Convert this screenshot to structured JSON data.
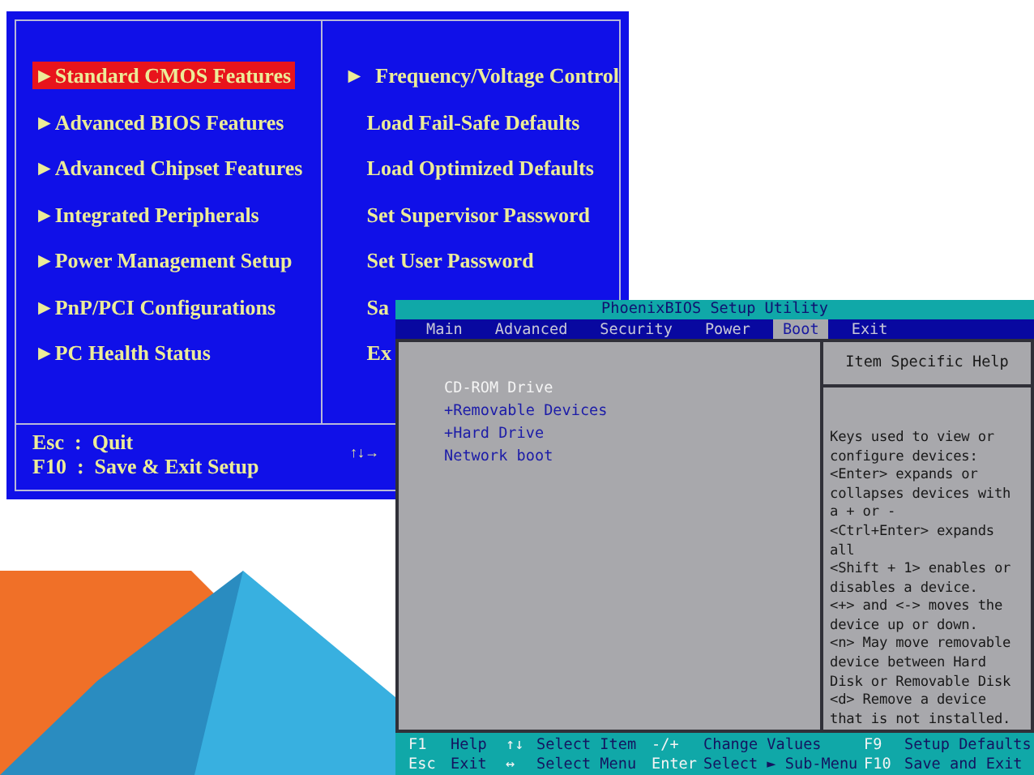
{
  "award_setup": {
    "left_menu": [
      {
        "arrow": "►",
        "label": "Standard CMOS Features",
        "selected": true
      },
      {
        "arrow": "►",
        "label": "Advanced BIOS Features",
        "selected": false
      },
      {
        "arrow": "►",
        "label": "Advanced Chipset Features",
        "selected": false
      },
      {
        "arrow": "►",
        "label": "Integrated Peripherals",
        "selected": false
      },
      {
        "arrow": "►",
        "label": "Power Management Setup",
        "selected": false
      },
      {
        "arrow": "►",
        "label": "PnP/PCI Configurations",
        "selected": false
      },
      {
        "arrow": "►",
        "label": "PC Health Status",
        "selected": false
      }
    ],
    "right_menu": [
      {
        "arrow": "►",
        "label": "Frequency/Voltage Control"
      },
      {
        "label": "Load Fail-Safe Defaults"
      },
      {
        "label": "Load Optimized Defaults"
      },
      {
        "label": "Set Supervisor Password"
      },
      {
        "label": "Set User Password"
      },
      {
        "label": "Sa"
      },
      {
        "label": "Ex"
      }
    ],
    "footer": [
      "Esc  :  Quit",
      "F10  :  Save & Exit Setup"
    ],
    "footer_keys": "↑↓→"
  },
  "phoenix_setup": {
    "title": "PhoenixBIOS Setup Utility",
    "tabs": [
      {
        "label": "Main",
        "selected": false
      },
      {
        "label": "Advanced",
        "selected": false
      },
      {
        "label": "Security",
        "selected": false
      },
      {
        "label": "Power",
        "selected": false
      },
      {
        "label": "Boot",
        "selected": true
      },
      {
        "label": "Exit",
        "selected": false
      }
    ],
    "boot_items": [
      {
        "label": "CD-ROM Drive",
        "selected": true
      },
      {
        "label": "+Removable Devices",
        "selected": false
      },
      {
        "label": "+Hard Drive",
        "selected": false
      },
      {
        "label": "Network boot",
        "selected": false
      }
    ],
    "help_title": "Item Specific Help",
    "help_lines": [
      "Keys used to view or",
      "configure devices:",
      "<Enter> expands or",
      "collapses devices with",
      "a + or -",
      "<Ctrl+Enter> expands",
      "all",
      "<Shift + 1> enables or",
      "disables a device.",
      "<+> and <-> moves the",
      "device up or down.",
      "<n> May move removable",
      "device between Hard",
      "Disk or Removable Disk",
      "<d> Remove a device",
      "that is not installed."
    ],
    "footer": [
      {
        "key": "F1",
        "label": "Help"
      },
      {
        "key": "↑↓",
        "label": "Select Item"
      },
      {
        "key": "-/+",
        "label": "Change Values"
      },
      {
        "key": "F9",
        "label": "Setup Defaults"
      },
      {
        "key": "Esc",
        "label": "Exit"
      },
      {
        "key": "↔",
        "label": "Select Menu"
      },
      {
        "key": "Enter",
        "label": "Select ► Sub-Menu"
      },
      {
        "key": "F10",
        "label": "Save and Exit"
      }
    ]
  }
}
